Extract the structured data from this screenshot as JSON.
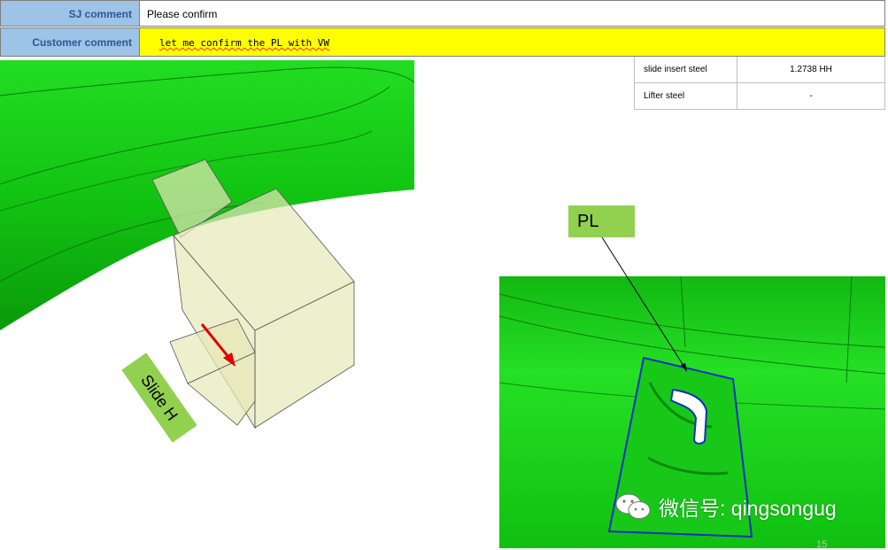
{
  "comments": {
    "sj": {
      "label": "SJ comment",
      "value": "Please confirm"
    },
    "customer": {
      "label": "Customer comment",
      "value": "let me confirm the PL with VW"
    }
  },
  "steel_table": [
    {
      "name": "slide insert steel",
      "value": "1.2738 HH"
    },
    {
      "name": "Lifter   steel",
      "value": "-"
    }
  ],
  "annotations": {
    "pl": "PL",
    "slide": "Slide H"
  },
  "watermark": {
    "text": "微信号: qingsongug",
    "icon": "wechat-icon"
  },
  "page_number": "15",
  "colors": {
    "part_green": "#1ED41E",
    "label_green": "#92D050",
    "header_blue": "#9DC3E6",
    "highlight_yellow": "#FFFF00",
    "outline_blue": "#1030C0",
    "arrow_red": "#E00000"
  }
}
